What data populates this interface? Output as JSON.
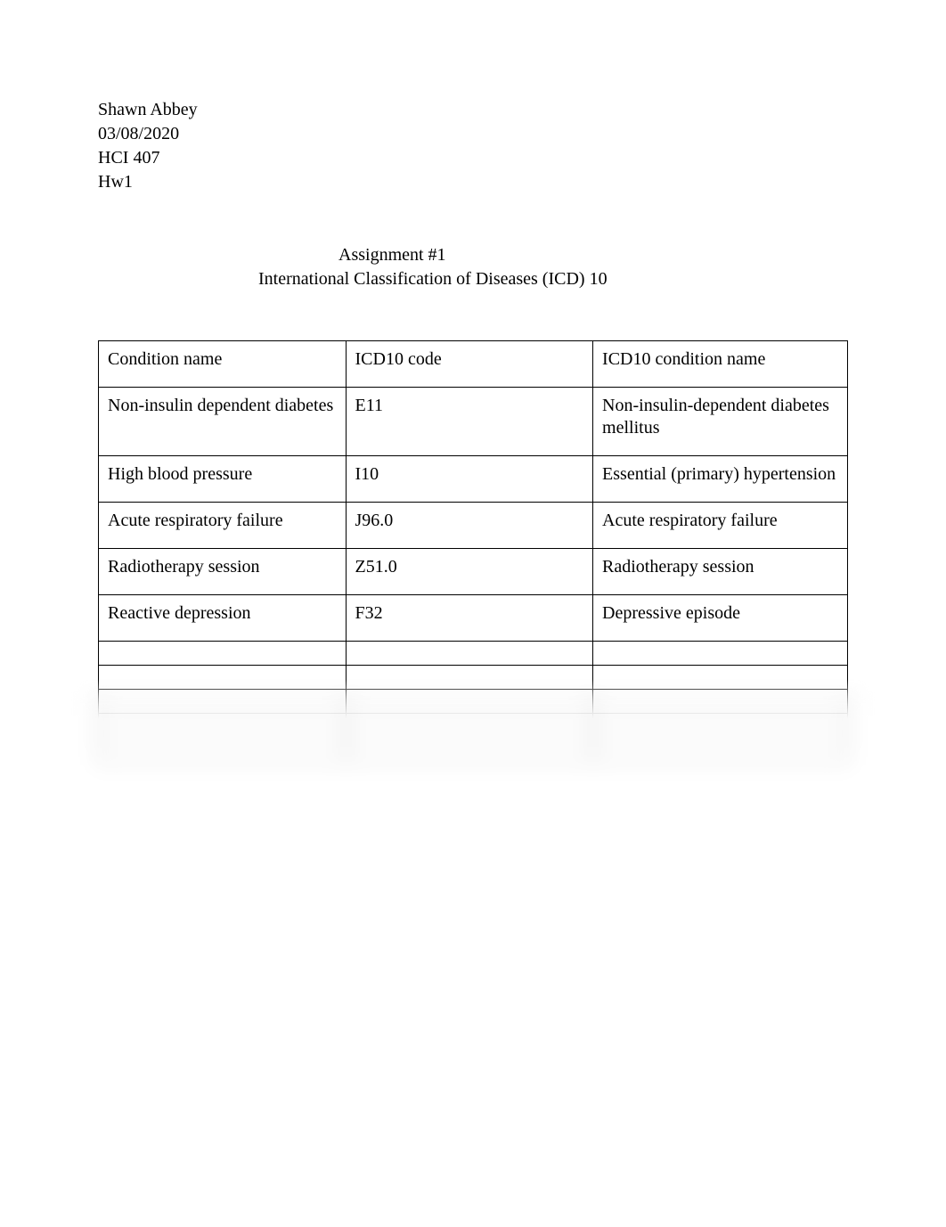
{
  "header": {
    "name": "Shawn Abbey",
    "date": "03/08/2020",
    "course": "HCI 407",
    "hw": "Hw1"
  },
  "title": {
    "line1": "Assignment #1",
    "line2": "International Classification of Diseases (ICD) 10"
  },
  "table": {
    "headers": {
      "col1": "Condition name",
      "col2": "ICD10 code",
      "col3": "ICD10 condition name"
    },
    "rows": [
      {
        "condition": "Non-insulin dependent diabetes",
        "code": "  E11",
        "icd_name": "Non-insulin-dependent diabetes mellitus"
      },
      {
        "condition": "High blood pressure",
        "code": "I10",
        "icd_name": "Essential (primary) hypertension"
      },
      {
        "condition": "Acute respiratory failure",
        "code": "J96.0",
        "icd_name": "Acute respiratory failure"
      },
      {
        "condition": "Radiotherapy session",
        "code": "Z51.0",
        "icd_name": "Radiotherapy session"
      },
      {
        "condition": "Reactive depression",
        "code": "F32",
        "icd_name": "Depressive episode"
      },
      {
        "condition": "",
        "code": "",
        "icd_name": ""
      },
      {
        "condition": "",
        "code": "",
        "icd_name": ""
      },
      {
        "condition": "",
        "code": "",
        "icd_name": ""
      },
      {
        "condition": "",
        "code": "",
        "icd_name": ""
      },
      {
        "condition": "",
        "code": "",
        "icd_name": ""
      }
    ]
  }
}
